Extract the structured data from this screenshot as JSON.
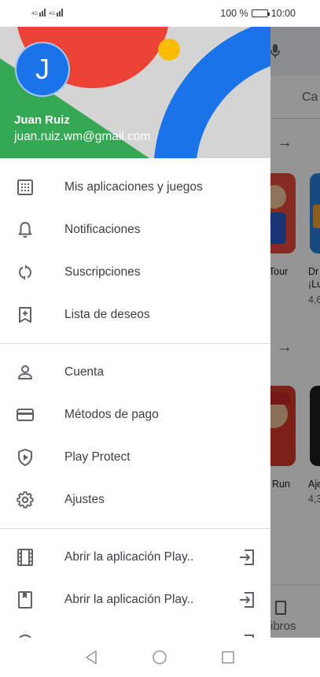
{
  "status_bar": {
    "signal_1": "4G",
    "signal_2": "4G",
    "battery_percent": "100 %",
    "battery_level": 1.0,
    "time": "10:00"
  },
  "drawer": {
    "header": {
      "avatar_letter": "J",
      "name": "Juan Ruiz",
      "email": "juan.ruiz.wm@gmail.com"
    },
    "section_1": [
      {
        "label": "Mis aplicaciones y juegos",
        "icon": "apps-grid-icon"
      },
      {
        "label": "Notificaciones",
        "icon": "bell-icon"
      },
      {
        "label": "Suscripciones",
        "icon": "refresh-icon"
      },
      {
        "label": "Lista de deseos",
        "icon": "bookmark-add-icon"
      }
    ],
    "section_2": [
      {
        "label": "Cuenta",
        "icon": "person-icon"
      },
      {
        "label": "Métodos de pago",
        "icon": "credit-card-icon"
      },
      {
        "label": "Play Protect",
        "icon": "shield-play-icon"
      },
      {
        "label": "Ajustes",
        "icon": "gear-icon"
      }
    ],
    "section_3": [
      {
        "label": "Abrir la aplicación Play..",
        "icon": "film-icon",
        "trailing": "open-app-icon"
      },
      {
        "label": "Abrir la aplicación Play..",
        "icon": "book-icon",
        "trailing": "open-app-icon"
      }
    ]
  },
  "background": {
    "category_tab": "Ca",
    "card_1_title": "Tour",
    "card_2_title_a": "Dr",
    "card_2_title_b": "¡Lu",
    "card_2_rating": "4,6",
    "card_3_title": "Run",
    "card_4_title": "Aje",
    "card_4_rating": "4,3",
    "bottom_nav_label": "ibros"
  },
  "colors": {
    "brand_blue": "#1a73e8",
    "header_green": "#34a853",
    "header_red": "#ea4335",
    "header_yellow": "#fbbc04",
    "header_grey": "#d4d4d4"
  },
  "nav_bar": {
    "back": "back-icon",
    "home": "home-icon",
    "recents": "recents-icon"
  }
}
